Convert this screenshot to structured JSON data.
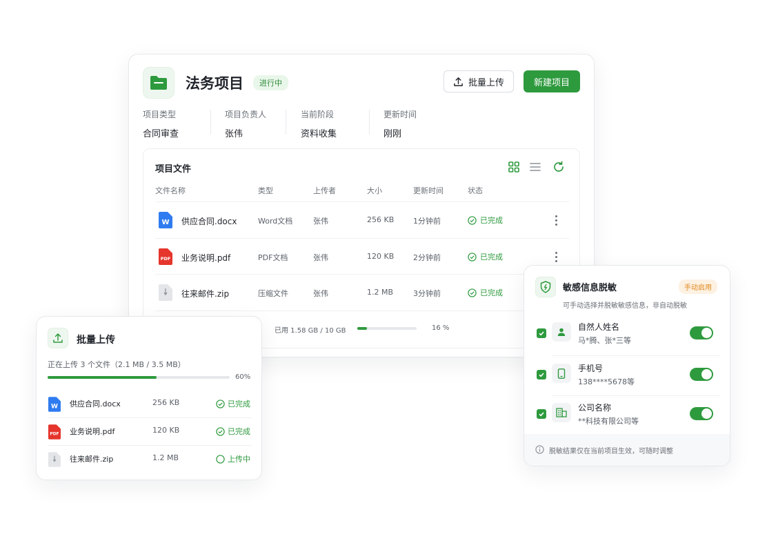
{
  "project": {
    "title": "法务项目",
    "status": "进行中",
    "upload_label": "批量上传",
    "new_label": "新建项目",
    "meta": [
      {
        "label": "项目类型",
        "value": "合同审查"
      },
      {
        "label": "项目负责人",
        "value": "张伟"
      },
      {
        "label": "当前阶段",
        "value": "资料收集"
      },
      {
        "label": "更新时间",
        "value": "刚刚"
      }
    ]
  },
  "files": {
    "title": "项目文件",
    "columns": [
      "文件名称",
      "类型",
      "上传者",
      "大小",
      "更新时间",
      "状态"
    ],
    "rows": [
      {
        "name": "供应合同.docx",
        "type": "Word文档",
        "uploader": "张伟",
        "size": "256 KB",
        "time": "1分钟前",
        "status": "已完成",
        "icon": "word-file-icon",
        "icon_text": "W"
      },
      {
        "name": "业务说明.pdf",
        "type": "PDF文档",
        "uploader": "张伟",
        "size": "120 KB",
        "time": "2分钟前",
        "status": "已完成",
        "icon": "pdf-file-icon",
        "icon_text": "PDF"
      },
      {
        "name": "往来邮件.zip",
        "type": "压缩文件",
        "uploader": "张伟",
        "size": "1.2 MB",
        "time": "3分钟前",
        "status": "已完成",
        "icon": "zip-file-icon",
        "icon_text": ""
      }
    ],
    "storage_text": "已用 1.58 GB / 10 GB",
    "storage_percent": 16,
    "storage_percent_label": "16 %"
  },
  "upload": {
    "title": "批量上传",
    "status_text": "正在上传 3 个文件（2.1 MB / 3.5 MB）",
    "progress": 60,
    "progress_label": "60%",
    "items": [
      {
        "name": "供应合同.docx",
        "size": "256 KB",
        "status": "已完成",
        "icon_text": "W"
      },
      {
        "name": "业务说明.pdf",
        "size": "120 KB",
        "status": "已完成",
        "icon_text": "PDF"
      },
      {
        "name": "往来邮件.zip",
        "size": "1.2 MB",
        "status": "上传中",
        "icon_text": ""
      }
    ]
  },
  "desensitize": {
    "title": "敏感信息脱敏",
    "badge": "手动启用",
    "description": "可手动选择并脱敏敏感信息，非自动脱敏",
    "items": [
      {
        "name": "自然人姓名",
        "example": "马*腾、张*三等",
        "enabled": true
      },
      {
        "name": "手机号",
        "example": "138****5678等",
        "enabled": true
      },
      {
        "name": "公司名称",
        "example": "**科技有限公司等",
        "enabled": true
      }
    ],
    "footer": "脱敏结果仅在当前项目生效，可随时调整"
  },
  "colors": {
    "accent": "#2e9a3e",
    "word": "#2f7cf0",
    "pdf": "#e5352c",
    "warn": "#e08a1e"
  }
}
